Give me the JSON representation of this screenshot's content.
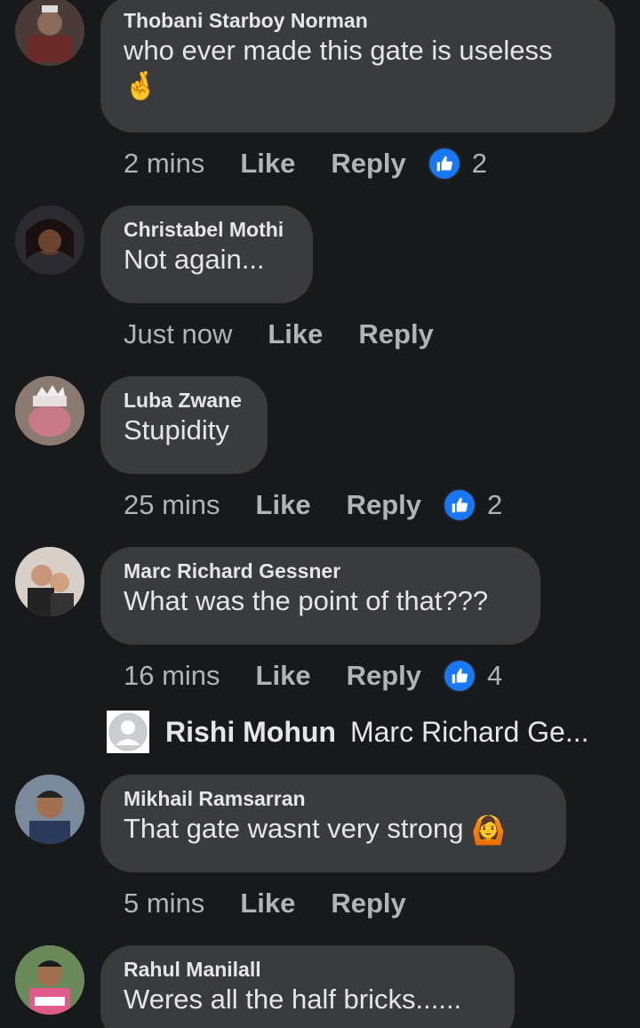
{
  "comments": [
    {
      "author": "Thobani Starboy Norman",
      "text": "who ever made this gate is useless",
      "emoji_line": "🤞",
      "time": "2 mins",
      "like_label": "Like",
      "reply_label": "Reply",
      "reaction_count": "2",
      "reaction_icon": "thumbs-up-icon"
    },
    {
      "author": "Christabel Mothi",
      "text": "Not again...",
      "time": "Just now",
      "like_label": "Like",
      "reply_label": "Reply"
    },
    {
      "author": "Luba Zwane",
      "text": "Stupidity",
      "time": "25 mins",
      "like_label": "Like",
      "reply_label": "Reply",
      "reaction_count": "2",
      "reaction_icon": "thumbs-up-icon"
    },
    {
      "author": "Marc Richard Gessner",
      "text": "What was the point of that???",
      "time": "16 mins",
      "like_label": "Like",
      "reply_label": "Reply",
      "reaction_count": "4",
      "reaction_icon": "thumbs-up-icon"
    },
    {
      "author": "Mikhail Ramsarran",
      "text": "That gate wasnt very strong",
      "emoji": "🙆",
      "time": "5 mins",
      "like_label": "Like",
      "reply_label": "Reply"
    },
    {
      "author": "Rahul Manilall",
      "text": "Weres all the half bricks......"
    }
  ],
  "reply_preview": {
    "name": "Rishi Mohun",
    "snippet": "Marc Richard Ge...",
    "avatar_icon": "default-avatar-icon"
  },
  "colors": {
    "background": "#18191a",
    "bubble": "#3a3b3c",
    "text": "#e4e6eb",
    "meta": "#b0b3b8",
    "like_blue": "#1877f2"
  }
}
